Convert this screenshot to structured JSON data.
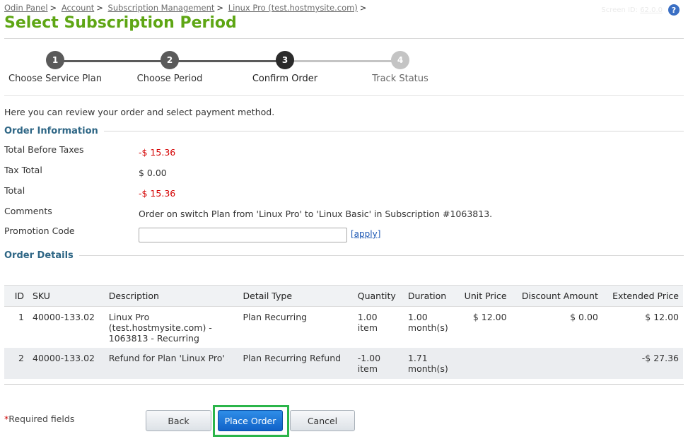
{
  "breadcrumb": [
    "Odin Panel",
    "Account",
    "Subscription Management",
    "Linux Pro (test.hostmysite.com)"
  ],
  "screen_id": {
    "label": "Screen ID:",
    "value": "62.0.0"
  },
  "page_title": "Select Subscription Period",
  "wizard": {
    "steps": [
      {
        "num": "1",
        "label": "Choose Service Plan",
        "state": "done"
      },
      {
        "num": "2",
        "label": "Choose Period",
        "state": "done"
      },
      {
        "num": "3",
        "label": "Confirm Order",
        "state": "current"
      },
      {
        "num": "4",
        "label": "Track Status",
        "state": "pending"
      }
    ]
  },
  "intro": "Here you can review your order and select payment method.",
  "order_info": {
    "heading": "Order Information",
    "total_before_taxes_label": "Total Before Taxes",
    "total_before_taxes": "-$ 15.36",
    "tax_total_label": "Tax Total",
    "tax_total": "$ 0.00",
    "total_label": "Total",
    "total": "-$ 15.36",
    "comments_label": "Comments",
    "comments": "Order on switch Plan from 'Linux Pro' to 'Linux Basic' in Subscription #1063813.",
    "promo_label": "Promotion Code",
    "promo_value": "",
    "apply_label": "[apply]"
  },
  "order_details": {
    "heading": "Order Details",
    "columns": [
      "ID",
      "SKU",
      "Description",
      "Detail Type",
      "Quantity",
      "Duration",
      "Unit Price",
      "Discount Amount",
      "Extended Price"
    ],
    "rows": [
      {
        "id": "1",
        "sku": "40000-133.02",
        "description": [
          "Linux Pro",
          "(test.hostmysite.com) -",
          "1063813 - Recurring"
        ],
        "detail_type": "Plan Recurring",
        "quantity": [
          "1.00",
          "item"
        ],
        "duration": [
          "1.00",
          "month(s)"
        ],
        "unit_price": "$ 12.00",
        "discount": "$ 0.00",
        "extended": "$ 12.00"
      },
      {
        "id": "2",
        "sku": "40000-133.02",
        "description": [
          "Refund for Plan 'Linux Pro'"
        ],
        "detail_type": "Plan Recurring Refund",
        "quantity": [
          "-1.00",
          "item"
        ],
        "duration": [
          "1.71",
          "month(s)"
        ],
        "unit_price": "",
        "discount": "",
        "extended": "-$ 27.36"
      }
    ]
  },
  "footer": {
    "required_star": "*",
    "required_text": "Required fields",
    "back_label": "Back",
    "place_order_label": "Place Order",
    "cancel_label": "Cancel"
  },
  "colors": {
    "title_green": "#5ea614",
    "section_blue": "#2e6685",
    "negative_red": "#d40000",
    "step_done": "#5a5a5a",
    "step_current": "#2b2b2b",
    "step_pending": "#c4c4c4",
    "highlight_green": "#2bb54a"
  }
}
